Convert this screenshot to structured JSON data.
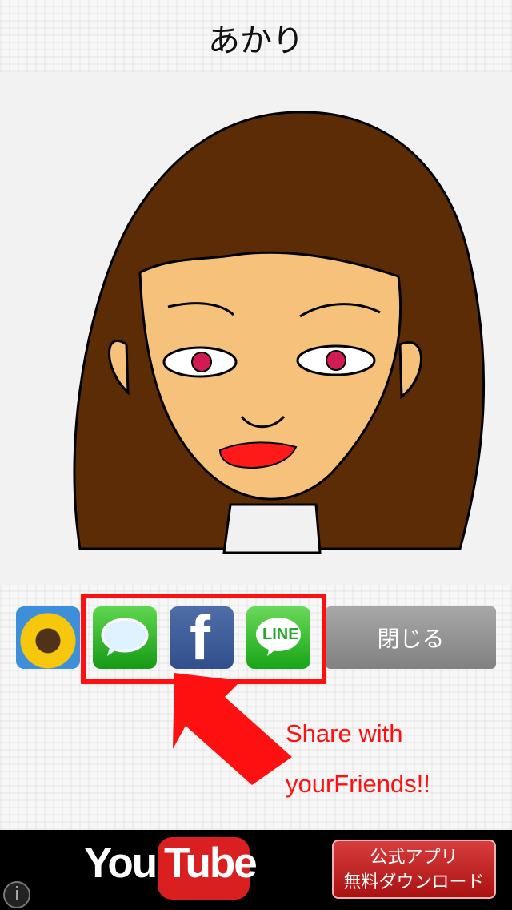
{
  "header": {
    "title": "あかり"
  },
  "toolbar": {
    "photo_icon": "sunflower-photo-icon",
    "message_icon": "message-bubble-icon",
    "facebook_icon": "facebook-icon",
    "facebook_label": "f",
    "line_icon": "line-icon",
    "line_label": "LINE",
    "close_label": "閉じる"
  },
  "share_hint": {
    "line1": "Share with",
    "line2": "yourFriends!!",
    "color": "#ff1010"
  },
  "ad": {
    "youtube_logo_text": "You",
    "youtube_logo_tube": "Tube",
    "official_app_line1": "公式アプリ",
    "official_app_line2": "無料ダウンロード",
    "info_label": "i"
  },
  "colors": {
    "hair": "#5b2c06",
    "skin": "#f6c17b",
    "lips": "#ff1a1a",
    "accent": "#ff1010"
  }
}
